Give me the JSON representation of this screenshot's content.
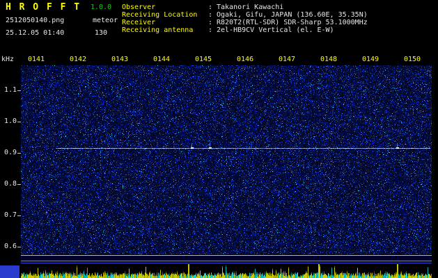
{
  "app": {
    "title": "H R O F F T",
    "version": "1.0.0",
    "filename": "2512050140.png",
    "mode": "meteor",
    "datetime": "25.12.05 01:40",
    "count": "130"
  },
  "info": {
    "separator": ":",
    "rows": [
      {
        "label": "Observer",
        "value": "Takanori Kawachi"
      },
      {
        "label": "Receiving Location",
        "value": "Ogaki, Gifu, JAPAN (136.60E, 35.35N)"
      },
      {
        "label": "Receiver",
        "value": "R820T2(RTL-SDR) SDR-Sharp 53.1000MHz"
      },
      {
        "label": "Receiving antenna",
        "value": "2el-HB9CV Vertical (el. E-W)"
      }
    ]
  },
  "axes": {
    "unit": "kHz",
    "time_labels": [
      "0141",
      "0142",
      "0143",
      "0144",
      "0145",
      "0146",
      "0147",
      "0148",
      "0149",
      "0150"
    ],
    "freq_labels": [
      "1.1",
      "1.0",
      "0.9",
      "0.8",
      "0.7",
      "0.6"
    ]
  },
  "spectrogram": {
    "carrier": {
      "freq_khz": 0.915,
      "y_frac": 0.4375,
      "x_start_frac": 0.085
    },
    "echoes": [
      {
        "x_frac": 0.415
      },
      {
        "x_frac": 0.46
      },
      {
        "x_frac": 0.915
      }
    ],
    "level_spikes": [
      0.407,
      0.724,
      0.916
    ],
    "colors": {
      "background": "#000028",
      "noise_blue": "#2233cc",
      "carrier": "#aaffee",
      "label_yellow": "#ffff00",
      "label_white": "#e8e8e8",
      "version_green": "#00dd00",
      "bar_yellow": "#c8c800",
      "bar_cyan": "#00b4b4"
    }
  }
}
